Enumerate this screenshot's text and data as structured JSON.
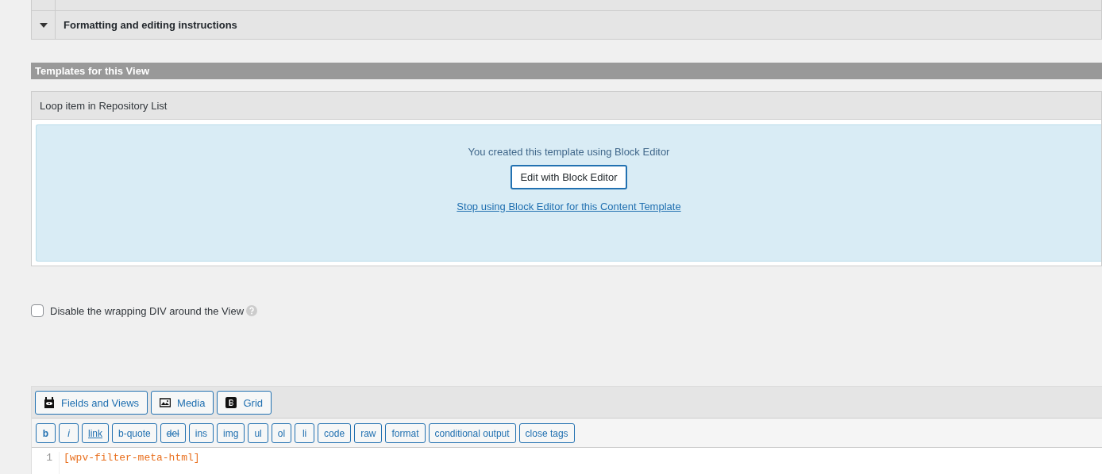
{
  "sections": [
    {
      "title": "Formatting and editing instructions",
      "expanded": false
    }
  ],
  "templates": {
    "heading": "Templates for this View",
    "item_title": "Loop item in Repository List",
    "notice": "You created this template using Block Editor",
    "edit_button": "Edit with Block Editor",
    "stop_link": "Stop using Block Editor for this Content Template"
  },
  "wrapping_option": {
    "label": "Disable the wrapping DIV around the View",
    "checked": false
  },
  "editor": {
    "media_buttons": [
      {
        "kind": "fields",
        "label": "Fields and Views"
      },
      {
        "kind": "media",
        "label": "Media"
      },
      {
        "kind": "grid",
        "label": "Grid"
      }
    ],
    "quicktags": [
      {
        "label": "b",
        "kind": "bold"
      },
      {
        "label": "i",
        "kind": "italic"
      },
      {
        "label": "link",
        "kind": "link"
      },
      {
        "label": "b-quote",
        "kind": "plain"
      },
      {
        "label": "del",
        "kind": "del"
      },
      {
        "label": "ins",
        "kind": "plain"
      },
      {
        "label": "img",
        "kind": "plain"
      },
      {
        "label": "ul",
        "kind": "plain"
      },
      {
        "label": "ol",
        "kind": "plain"
      },
      {
        "label": "li",
        "kind": "plain"
      },
      {
        "label": "code",
        "kind": "plain"
      },
      {
        "label": "raw",
        "kind": "plain"
      },
      {
        "label": "format",
        "kind": "plain"
      },
      {
        "label": "conditional output",
        "kind": "plain"
      },
      {
        "label": "close tags",
        "kind": "plain"
      }
    ],
    "lines": [
      {
        "number": "1",
        "text": "[wpv-filter-meta-html]"
      }
    ]
  }
}
